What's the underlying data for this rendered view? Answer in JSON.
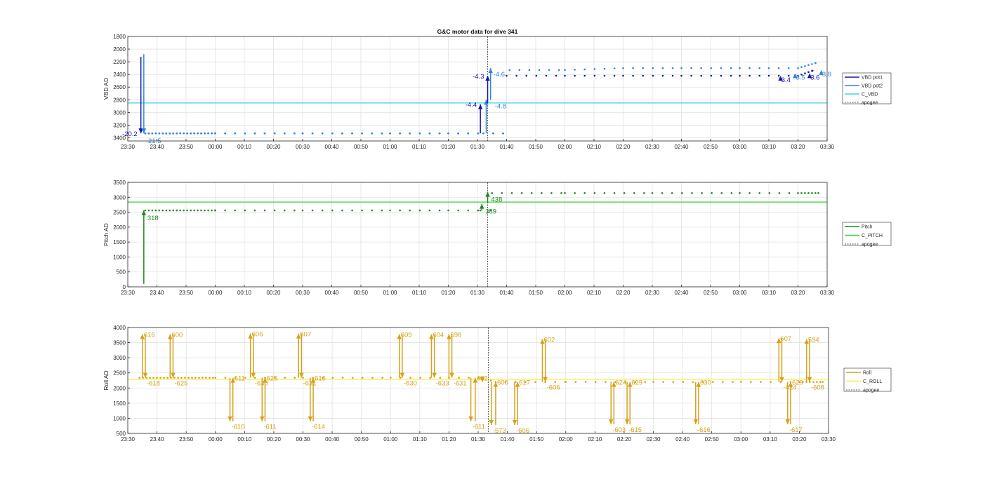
{
  "figure_title": "G&C motor data for dive 341",
  "colors": {
    "vbd_pot1": "#1515b0",
    "vbd_pot2": "#2f86e0",
    "c_vbd": "#47d4e8",
    "pitch": "#1f8a1f",
    "c_pitch": "#35d435",
    "roll": "#d4a21a",
    "c_roll": "#f5ea4a",
    "apogee": "#555555"
  },
  "chart_data": [
    {
      "type": "scatter",
      "title": "G&C motor data for dive 341",
      "ylabel": "VBD AD",
      "xlabel": "",
      "x_ticks": [
        "23:30",
        "23:40",
        "23:50",
        "00:00",
        "00:10",
        "00:20",
        "00:30",
        "00:40",
        "00:50",
        "01:00",
        "01:10",
        "01:20",
        "01:30",
        "01:40",
        "01:50",
        "02:00",
        "02:10",
        "02:20",
        "02:30",
        "02:40",
        "02:50",
        "03:00",
        "03:10",
        "03:20",
        "03:30"
      ],
      "xlim_minutes": [
        0,
        240
      ],
      "ylim": [
        1800,
        3450
      ],
      "y_reversed": true,
      "y_ticks": [
        1800,
        2000,
        2200,
        2400,
        2600,
        2800,
        3000,
        3200,
        3400
      ],
      "grid": true,
      "legend": {
        "placement": "right",
        "entries": [
          "VBD pot1",
          "VBD pot2",
          "C_VBD",
          "apogee"
        ]
      },
      "apogee_minute": 123.5,
      "reference_line": {
        "name": "C_VBD",
        "value": 2850
      },
      "series": [
        {
          "name": "VBD pot1",
          "x": [
            6,
            30,
            60,
            90,
            110,
            122,
            130,
            150,
            170,
            190,
            210,
            220,
            230,
            235
          ],
          "y": [
            3330,
            3330,
            3330,
            3330,
            3330,
            3330,
            2420,
            2420,
            2420,
            2420,
            2420,
            2420,
            2420,
            2340
          ]
        },
        {
          "name": "VBD pot2",
          "x": [
            6,
            30,
            60,
            90,
            110,
            122,
            131,
            150,
            170,
            190,
            210,
            220,
            230,
            236
          ],
          "y": [
            3330,
            3330,
            3330,
            3330,
            3330,
            3330,
            2330,
            2330,
            2300,
            2300,
            2300,
            2300,
            2300,
            2220
          ]
        }
      ],
      "moves": [
        {
          "x": 4.5,
          "from": 2120,
          "to": 3330,
          "label": "-20.2",
          "series": "VBD pot1",
          "label_side": "left"
        },
        {
          "x": 5.5,
          "from": 2080,
          "to": 3330,
          "label": "-21.5",
          "series": "VBD pot2",
          "label_side": "below"
        },
        {
          "x": 121,
          "from": 3330,
          "to": 2870,
          "label": "-4.4",
          "series": "VBD pot1",
          "label_side": "left"
        },
        {
          "x": 123,
          "from": 3330,
          "to": 2800,
          "label": "",
          "series": "VBD pot2",
          "label_side": "none"
        },
        {
          "x": 123.5,
          "from": 2850,
          "to": 2420,
          "label": "-4.3",
          "series": "VBD pot1",
          "label_side": "left"
        },
        {
          "x": 124.5,
          "from": 2800,
          "to": 2300,
          "label": "-4.6",
          "series": "VBD pot2",
          "label_side": "right"
        },
        {
          "x": 125,
          "from": 2800,
          "to": 2800,
          "label": "-4.8",
          "series": "VBD pot2",
          "label_side": "right"
        }
      ],
      "end_labels": [
        {
          "x": 224,
          "y": 2420,
          "text": "-3.4"
        },
        {
          "x": 229,
          "y": 2380,
          "text": "-3.5"
        },
        {
          "x": 234,
          "y": 2380,
          "text": "-3.6"
        },
        {
          "x": 238,
          "y": 2330,
          "text": "-3.8"
        }
      ]
    },
    {
      "type": "scatter",
      "ylabel": "Pitch AD",
      "xlabel": "",
      "x_ticks": [
        "23:30",
        "23:40",
        "23:50",
        "00:00",
        "00:10",
        "00:20",
        "00:30",
        "00:40",
        "00:50",
        "01:00",
        "01:10",
        "01:20",
        "01:30",
        "01:40",
        "01:50",
        "02:00",
        "02:10",
        "02:20",
        "02:30",
        "02:40",
        "02:50",
        "03:00",
        "03:10",
        "03:20",
        "03:30"
      ],
      "xlim_minutes": [
        0,
        240
      ],
      "ylim": [
        0,
        3500
      ],
      "y_ticks": [
        0,
        500,
        1000,
        1500,
        2000,
        2500,
        3000,
        3500
      ],
      "grid": true,
      "legend": {
        "placement": "right",
        "entries": [
          "Pitch",
          "C_PITCH",
          "apogee"
        ]
      },
      "apogee_minute": 123.5,
      "reference_line": {
        "name": "C_PITCH",
        "value": 2840
      },
      "series": [
        {
          "name": "Pitch",
          "x": [
            6,
            30,
            60,
            90,
            110,
            121,
            125,
            150,
            180,
            210,
            230,
            237
          ],
          "y": [
            2560,
            2560,
            2560,
            2560,
            2560,
            2560,
            3140,
            3140,
            3140,
            3140,
            3140,
            3140
          ]
        }
      ],
      "moves": [
        {
          "x": 5.5,
          "from": 100,
          "to": 2560,
          "label": "318"
        },
        {
          "x": 121.5,
          "from": 2560,
          "to": 2780,
          "label": "389"
        },
        {
          "x": 123.5,
          "from": 2800,
          "to": 3180,
          "label": "438"
        }
      ]
    },
    {
      "type": "scatter",
      "ylabel": "Roll AD",
      "xlabel": "",
      "x_ticks": [
        "23:30",
        "23:40",
        "23:50",
        "00:00",
        "00:10",
        "00:20",
        "00:30",
        "00:40",
        "00:50",
        "01:00",
        "01:10",
        "01:20",
        "01:30",
        "01:40",
        "01:50",
        "02:00",
        "02:10",
        "02:20",
        "02:30",
        "02:40",
        "02:50",
        "03:00",
        "03:10",
        "03:20",
        "03:30"
      ],
      "xlim_minutes": [
        0,
        240
      ],
      "ylim": [
        500,
        4000
      ],
      "y_ticks": [
        500,
        1000,
        1500,
        2000,
        2500,
        3000,
        3500,
        4000
      ],
      "grid": true,
      "legend": {
        "placement": "right",
        "entries": [
          "Roll",
          "C_ROLL",
          "apogee"
        ]
      },
      "apogee_minute": 123.5,
      "reference_line": {
        "name": "C_ROLL",
        "value": 2290
      },
      "series": [
        {
          "name": "Roll",
          "x": [
            4,
            30,
            60,
            90,
            110,
            121,
            126,
            150,
            180,
            210,
            230,
            238
          ],
          "y": [
            2340,
            2340,
            2340,
            2340,
            2340,
            2340,
            2200,
            2200,
            2200,
            2200,
            2200,
            2200
          ]
        }
      ],
      "moves": [
        {
          "x": 5,
          "from": 2340,
          "to": 3780,
          "label": "616",
          "label_side": "top"
        },
        {
          "x": 6,
          "from": 3780,
          "to": 2340,
          "label": "-618",
          "label_side": "bottom"
        },
        {
          "x": 14.5,
          "from": 2340,
          "to": 3780,
          "label": "600",
          "label_side": "top"
        },
        {
          "x": 15.5,
          "from": 3780,
          "to": 2340,
          "label": "-625",
          "label_side": "bottom"
        },
        {
          "x": 35,
          "from": 2340,
          "to": 900,
          "label": "-610",
          "label_side": "bottom"
        },
        {
          "x": 36,
          "from": 900,
          "to": 2340,
          "label": "611",
          "label_side": "top"
        },
        {
          "x": 42,
          "from": 2340,
          "to": 3800,
          "label": "606",
          "label_side": "top"
        },
        {
          "x": 43,
          "from": 3800,
          "to": 2340,
          "label": "-630",
          "label_side": "bottom"
        },
        {
          "x": 46,
          "from": 2340,
          "to": 900,
          "label": "-611",
          "label_side": "bottom"
        },
        {
          "x": 47,
          "from": 900,
          "to": 2340,
          "label": "625",
          "label_side": "top"
        },
        {
          "x": 58.5,
          "from": 2340,
          "to": 3800,
          "label": "607",
          "label_side": "top"
        },
        {
          "x": 59.5,
          "from": 3800,
          "to": 2340,
          "label": "-631",
          "label_side": "bottom"
        },
        {
          "x": 62.5,
          "from": 2340,
          "to": 900,
          "label": "-614",
          "label_side": "bottom"
        },
        {
          "x": 63.5,
          "from": 900,
          "to": 2340,
          "label": "616",
          "label_side": "top"
        },
        {
          "x": 93,
          "from": 2340,
          "to": 3780,
          "label": "609",
          "label_side": "top"
        },
        {
          "x": 94,
          "from": 3780,
          "to": 2340,
          "label": "-630",
          "label_side": "bottom"
        },
        {
          "x": 104,
          "from": 2340,
          "to": 3780,
          "label": "604",
          "label_side": "top"
        },
        {
          "x": 105,
          "from": 3780,
          "to": 2340,
          "label": "-633",
          "label_side": "bottom"
        },
        {
          "x": 110,
          "from": 2340,
          "to": 3780,
          "label": "598",
          "label_side": "top"
        },
        {
          "x": 111,
          "from": 3780,
          "to": 2340,
          "label": "-631",
          "label_side": "bottom"
        },
        {
          "x": 117.5,
          "from": 2340,
          "to": 900,
          "label": "-611",
          "label_side": "bottom"
        },
        {
          "x": 119,
          "from": 900,
          "to": 2340,
          "label": "632",
          "label_side": "top"
        },
        {
          "x": 121.5,
          "from": 2340,
          "to": 2200,
          "label": "",
          "label_side": "none"
        },
        {
          "x": 124.5,
          "from": 2200,
          "to": 780,
          "label": "-573",
          "label_side": "bottom"
        },
        {
          "x": 126,
          "from": 780,
          "to": 2200,
          "label": "600",
          "label_side": "top"
        },
        {
          "x": 132.5,
          "from": 2200,
          "to": 780,
          "label": "-606",
          "label_side": "bottom"
        },
        {
          "x": 133.5,
          "from": 780,
          "to": 2200,
          "label": "617",
          "label_side": "top"
        },
        {
          "x": 142,
          "from": 2200,
          "to": 3620,
          "label": "602",
          "label_side": "top"
        },
        {
          "x": 143,
          "from": 3620,
          "to": 2200,
          "label": "-606",
          "label_side": "bottom"
        },
        {
          "x": 165.5,
          "from": 2200,
          "to": 800,
          "label": "-603",
          "label_side": "bottom"
        },
        {
          "x": 166.5,
          "from": 800,
          "to": 2200,
          "label": "624",
          "label_side": "top"
        },
        {
          "x": 171,
          "from": 2200,
          "to": 800,
          "label": "-615",
          "label_side": "bottom"
        },
        {
          "x": 172,
          "from": 800,
          "to": 2200,
          "label": "629",
          "label_side": "top"
        },
        {
          "x": 194.5,
          "from": 2200,
          "to": 800,
          "label": "-616",
          "label_side": "bottom"
        },
        {
          "x": 195.5,
          "from": 800,
          "to": 2200,
          "label": "630",
          "label_side": "top"
        },
        {
          "x": 223,
          "from": 2200,
          "to": 3650,
          "label": "607",
          "label_side": "top"
        },
        {
          "x": 224,
          "from": 3650,
          "to": 2200,
          "label": "-624",
          "label_side": "bottom"
        },
        {
          "x": 226,
          "from": 2200,
          "to": 800,
          "label": "-617",
          "label_side": "bottom"
        },
        {
          "x": 227,
          "from": 800,
          "to": 2200,
          "label": "629",
          "label_side": "top"
        },
        {
          "x": 232.5,
          "from": 2200,
          "to": 3620,
          "label": "594",
          "label_side": "top"
        },
        {
          "x": 233.5,
          "from": 3620,
          "to": 2200,
          "label": "-608",
          "label_side": "bottom"
        }
      ]
    }
  ]
}
